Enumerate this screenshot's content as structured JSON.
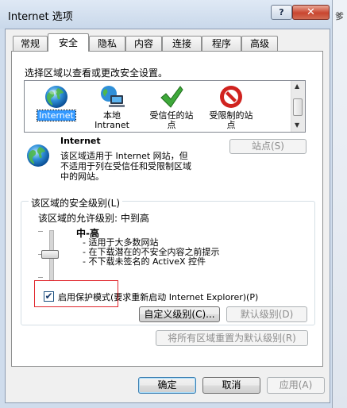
{
  "window": {
    "title": "Internet 选项",
    "help_label": "?",
    "close_label": "✕",
    "bg_window_label": "爹"
  },
  "tabs": [
    {
      "label": "常规",
      "active": false
    },
    {
      "label": "安全",
      "active": true
    },
    {
      "label": "隐私",
      "active": false
    },
    {
      "label": "内容",
      "active": false
    },
    {
      "label": "连接",
      "active": false
    },
    {
      "label": "程序",
      "active": false
    },
    {
      "label": "高级",
      "active": false
    }
  ],
  "security": {
    "instruction": "选择区域以查看或更改安全设置。",
    "zones": [
      {
        "label": "Internet",
        "icon": "globe-icon",
        "selected": true
      },
      {
        "label": "本地 Intranet",
        "icon": "intranet-icon",
        "selected": false
      },
      {
        "label": "受信任的站点",
        "icon": "checkmark-icon",
        "selected": false
      },
      {
        "label": "受限制的站点",
        "icon": "restricted-icon",
        "selected": false
      }
    ],
    "sites_button": "站点(S)",
    "zone_title": "Internet",
    "zone_description": [
      "该区域适用于 Internet 网站，但",
      "不适用于列在受信任和受限制区域",
      "中的网站。"
    ],
    "level_group_label": "该区域的安全级别(L)",
    "allowed_levels": "该区域的允许级别: 中到高",
    "level_name": "中-高",
    "level_bullets": [
      "- 适用于大多数网站",
      "- 在下载潜在的不安全内容之前提示",
      "- 不下载未签名的 ActiveX 控件"
    ],
    "protected_mode_label": "启用保护模式(要求重新启动 Internet Explorer)(P)",
    "protected_mode_checked": true,
    "custom_level_button": "自定义级别(C)...",
    "default_level_button": "默认级别(D)",
    "reset_all_button": "将所有区域重置为默认级别(R)"
  },
  "footer": {
    "ok_button": "确定",
    "cancel_button": "取消",
    "apply_button": "应用(A)"
  },
  "colors": {
    "selection": "#3399ff",
    "highlight_border": "#e0262c"
  }
}
